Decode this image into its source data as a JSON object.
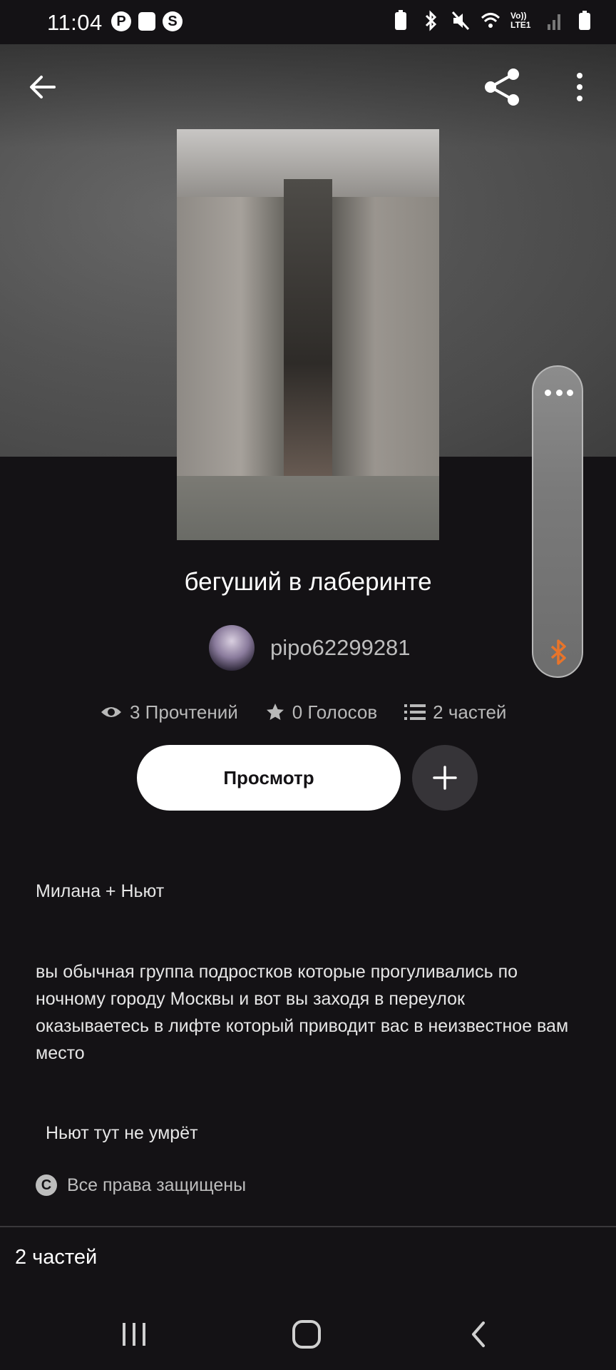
{
  "status_bar": {
    "time": "11:04",
    "left_icons": [
      "pinterest-icon",
      "calendar-icon",
      "shazam-icon"
    ],
    "right_icons": [
      "battery-saver-icon",
      "bluetooth-icon",
      "mute-icon",
      "wifi-icon",
      "volte-lte1-icon",
      "signal-icon",
      "battery-icon"
    ],
    "network_label": "Vo)) LTE1"
  },
  "header": {
    "back_icon": "arrow-left-icon",
    "share_icon": "share-icon",
    "more_icon": "more-vertical-icon"
  },
  "book": {
    "title": "бегуший в лаберинте",
    "author": "pipo62299281",
    "stats": {
      "reads": "3 Прочтений",
      "votes": "0 Голосов",
      "parts": "2 частей"
    },
    "read_button": "Просмотр",
    "add_icon": "plus-icon"
  },
  "description": {
    "line1": "Милана + Ньют",
    "paragraph": "вы обычная группа подростков которые прогуливались по ночному городу Москвы и вот вы заходя в переулок оказываетесь в лифте который приводит вас в неизвестное вам место",
    "line3": " Ньют тут не умрёт",
    "copyright": "Все права защищены"
  },
  "footer": {
    "parts_label": "2 частей"
  },
  "floating_panel": {
    "icons": [
      "more-horizontal-icon",
      "bluetooth-icon"
    ],
    "bt_color": "#e8742a"
  },
  "nav_bar": {
    "icons": [
      "recent-apps-icon",
      "home-icon",
      "back-icon"
    ]
  },
  "colors": {
    "background": "#141215",
    "primary_button": "#ffffff",
    "secondary_button": "#363438"
  }
}
